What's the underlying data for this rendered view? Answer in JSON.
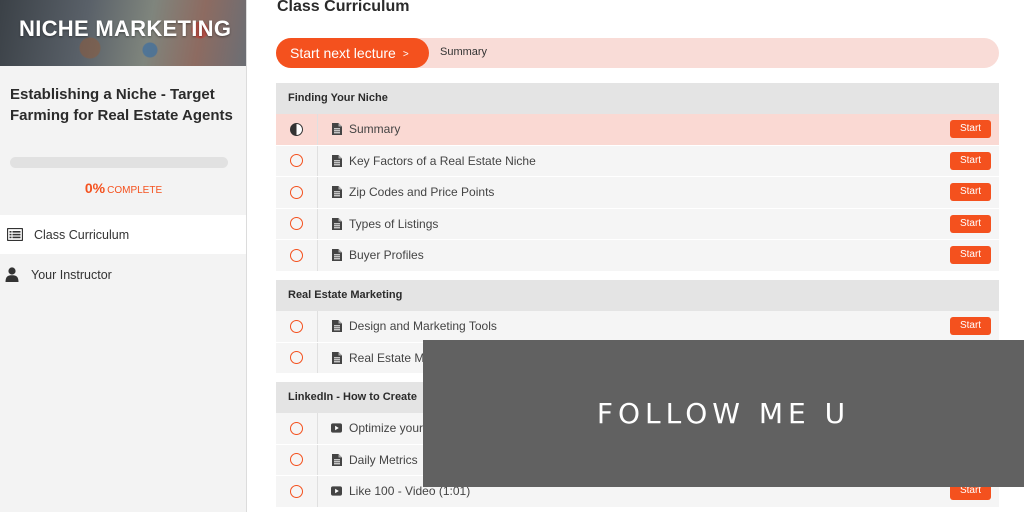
{
  "sidebar": {
    "banner_title": "NICHE MARKETING",
    "course_title": "Establishing a Niche - Target Farming for Real Estate Agents",
    "progress": {
      "percent": 0,
      "percent_label": "0%",
      "complete_label": "COMPLETE"
    },
    "nav": [
      {
        "label": "Class Curriculum",
        "icon": "list-icon",
        "active": true
      },
      {
        "label": "Your Instructor",
        "icon": "user-icon",
        "active": false
      }
    ]
  },
  "main": {
    "heading": "Class Curriculum",
    "next_button_label": "Start next lecture",
    "next_button_chevron": ">",
    "next_lecture_title": "Summary",
    "start_label": "Start",
    "sections": [
      {
        "title": "Finding Your Niche",
        "lectures": [
          {
            "title": "Summary",
            "type": "document",
            "status": "in-progress",
            "current": true,
            "show_start": true
          },
          {
            "title": "Key Factors of a Real Estate Niche",
            "type": "document",
            "status": "incomplete",
            "show_start": true
          },
          {
            "title": "Zip Codes and Price Points",
            "type": "document",
            "status": "incomplete",
            "show_start": true
          },
          {
            "title": "Types of Listings",
            "type": "document",
            "status": "incomplete",
            "show_start": true
          },
          {
            "title": "Buyer Profiles",
            "type": "document",
            "status": "incomplete",
            "show_start": true
          }
        ]
      },
      {
        "title": "Real Estate Marketing",
        "lectures": [
          {
            "title": "Design and Marketing Tools",
            "type": "document",
            "status": "incomplete",
            "show_start": true
          },
          {
            "title": "Real Estate Ma",
            "type": "document",
            "status": "incomplete",
            "show_start": false
          }
        ]
      },
      {
        "title": "LinkedIn - How to Create",
        "lectures": [
          {
            "title": "Optimize your",
            "type": "video",
            "status": "incomplete",
            "show_start": false
          },
          {
            "title": "Daily Metrics",
            "type": "document",
            "status": "incomplete",
            "show_start": false
          },
          {
            "title": "Like 100 - Video (1:01)",
            "type": "video",
            "status": "incomplete",
            "show_start": true
          }
        ]
      }
    ]
  },
  "overlay": {
    "text": "FOLLOW ME U"
  },
  "colors": {
    "accent": "#f4511e",
    "current_row": "#fad9d3",
    "next_bar": "#f9dcd7",
    "overlay": "#616161"
  }
}
